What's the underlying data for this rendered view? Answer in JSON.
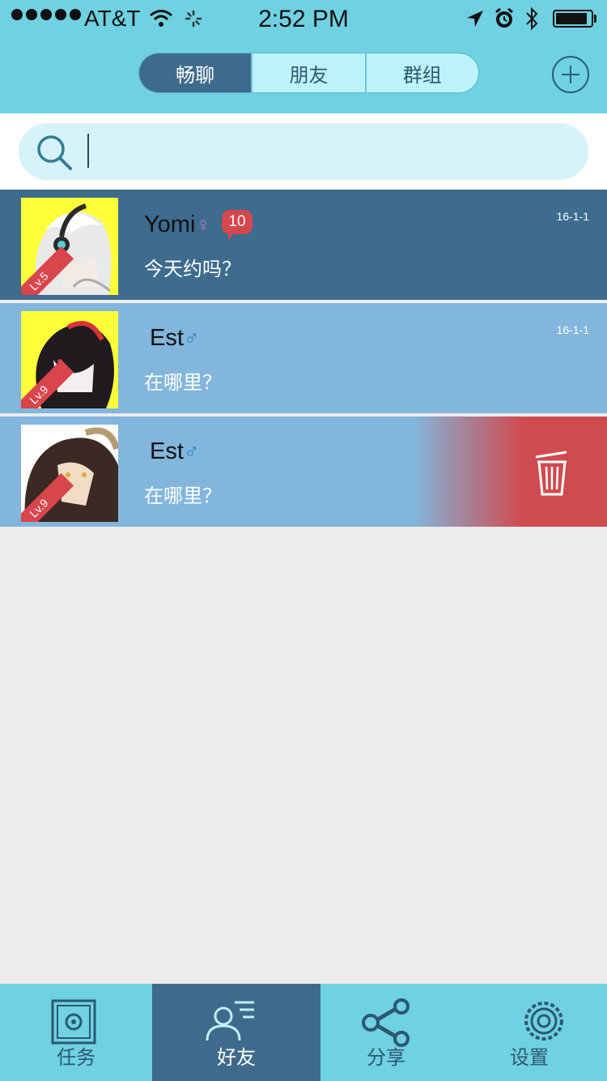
{
  "status_bar": {
    "carrier": "AT&T",
    "time": "2:52 PM"
  },
  "header": {
    "tabs": [
      {
        "label": "畅聊",
        "active": true
      },
      {
        "label": "朋友",
        "active": false
      },
      {
        "label": "群组",
        "active": false
      }
    ],
    "add_icon": "plus-circle-icon"
  },
  "search": {
    "placeholder": "",
    "value": ""
  },
  "chats": [
    {
      "name": "Yomi",
      "gender": "♀",
      "gender_color": "#a77bc7",
      "badge": "10",
      "message": "今天约吗？",
      "date": "16-1-1",
      "level": "Lv.5",
      "avatar_bg": "#ffff3a",
      "row_bg": "#3d6c8e",
      "selected": true
    },
    {
      "name": "Est",
      "gender": "♂",
      "gender_color": "#2d7fc4",
      "badge": "",
      "message": "在哪里？",
      "date": "16-1-1",
      "level": "Lv.9",
      "avatar_bg": "#ffff3a",
      "row_bg": "#82b6dc",
      "selected": false
    },
    {
      "name": "Est",
      "gender": "♂",
      "gender_color": "#2d7fc4",
      "badge": "",
      "message": "在哪里？",
      "date": "",
      "level": "Lv.9",
      "avatar_bg": "#ffffff",
      "row_bg": "#82b6dc",
      "delete_icon": "trash-icon",
      "delete_color": "#cf4b4f"
    }
  ],
  "tabbar": [
    {
      "label": "任务",
      "icon": "safe-icon",
      "active": false
    },
    {
      "label": "好友",
      "icon": "friends-icon",
      "active": true
    },
    {
      "label": "分享",
      "icon": "share-icon",
      "active": false
    },
    {
      "label": "设置",
      "icon": "gear-icon",
      "active": false
    }
  ],
  "colors": {
    "header": "#6fd1e2",
    "accent": "#3e6b8b",
    "background": "#ececec"
  }
}
